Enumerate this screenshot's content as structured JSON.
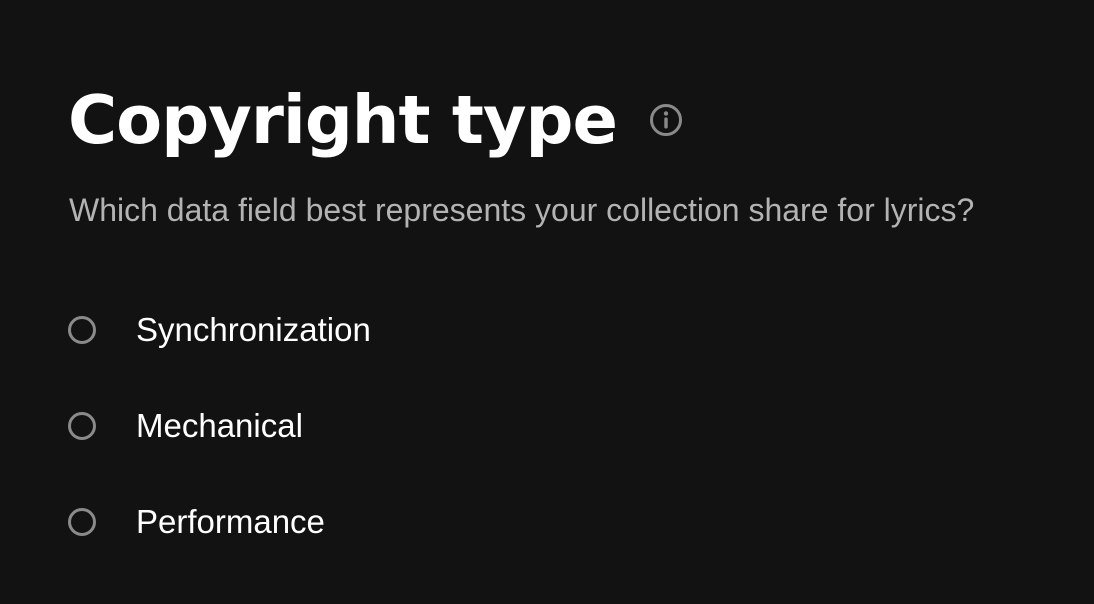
{
  "header": {
    "title": "Copyright type",
    "info_icon": "info-circle-icon"
  },
  "question": {
    "text": "Which data field best represents your collection share for lyrics?"
  },
  "options": [
    {
      "label": "Synchronization",
      "selected": false
    },
    {
      "label": "Mechanical",
      "selected": false
    },
    {
      "label": "Performance",
      "selected": false
    }
  ],
  "colors": {
    "background": "#121212",
    "title": "#ffffff",
    "subtitle": "#b3b3b3",
    "radio_border": "#8a8a8a"
  }
}
